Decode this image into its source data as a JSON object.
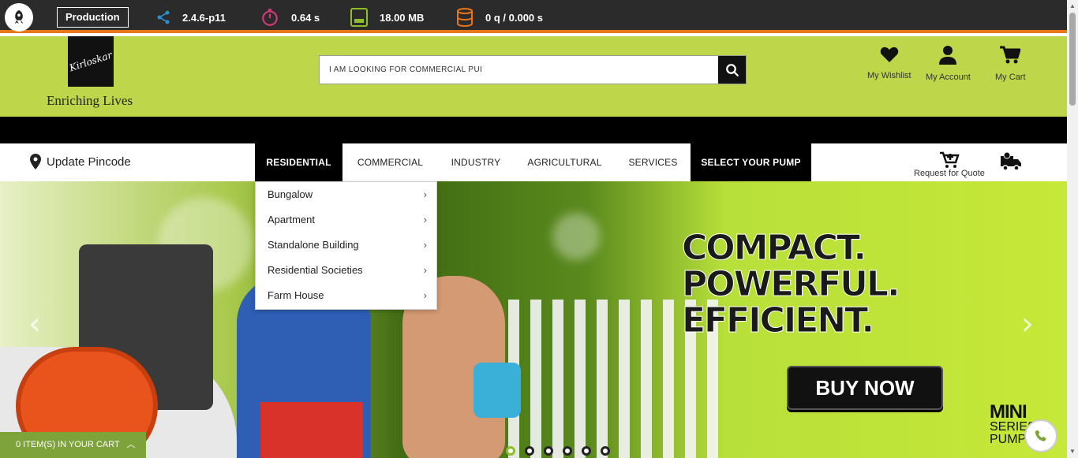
{
  "debug_bar": {
    "environment": "Production",
    "version": "2.4.6-p11",
    "time": "0.64 s",
    "memory": "18.00 MB",
    "queries": "0 q / 0.000 s"
  },
  "header": {
    "logo_text": "Kirloskar",
    "tagline": "Enriching Lives",
    "search": {
      "value": "I AM LOOKING FOR COMMERCIAL PUI"
    },
    "links": {
      "wishlist": "My Wishlist",
      "account": "My Account",
      "cart": "My Cart"
    }
  },
  "nav": {
    "pincode": "Update Pincode",
    "items": [
      "RESIDENTIAL",
      "COMMERCIAL",
      "INDUSTRY",
      "AGRICULTURAL",
      "SERVICES",
      "SELECT YOUR PUMP"
    ],
    "request_quote": "Request for Quote"
  },
  "dropdown": {
    "items": [
      "Bungalow",
      "Apartment",
      "Standalone Building",
      "Residential Societies",
      "Farm House"
    ]
  },
  "hero": {
    "headline": [
      "COMPACT.",
      "POWERFUL.",
      "EFFICIENT."
    ],
    "cta": "BUY NOW",
    "badge_main": "MINI",
    "badge_sub": "SERIES PUMP",
    "slides": 6,
    "active_slide": 1
  },
  "cart_tab": {
    "label": "0 ITEM(S) IN YOUR CART"
  },
  "colors": {
    "accent": "#bed64a",
    "debug_border": "#e8751a",
    "cart_tab": "#7ea33a"
  }
}
